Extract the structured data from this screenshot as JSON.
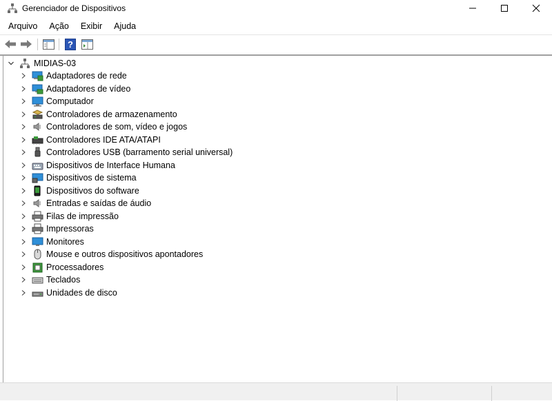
{
  "window": {
    "title": "Gerenciador de Dispositivos",
    "icon": "device-manager-icon"
  },
  "menu": [
    "Arquivo",
    "Ação",
    "Exibir",
    "Ajuda"
  ],
  "toolbar": {
    "icons": [
      "back-arrow-icon",
      "forward-arrow-icon",
      "show-hide-tree-icon",
      "help-icon",
      "properties-icon"
    ]
  },
  "tree": {
    "root": {
      "label": "MIDIAS-03",
      "icon": "computer-network-icon",
      "expanded": true
    },
    "items": [
      {
        "label": "Adaptadores de rede",
        "icon": "network-adapter-icon"
      },
      {
        "label": "Adaptadores de vídeo",
        "icon": "display-adapter-icon"
      },
      {
        "label": "Computador",
        "icon": "computer-icon"
      },
      {
        "label": "Controladores de armazenamento",
        "icon": "storage-controller-icon"
      },
      {
        "label": "Controladores de som, vídeo e jogos",
        "icon": "sound-icon"
      },
      {
        "label": "Controladores IDE ATA/ATAPI",
        "icon": "ide-controller-icon"
      },
      {
        "label": "Controladores USB (barramento serial universal)",
        "icon": "usb-icon"
      },
      {
        "label": "Dispositivos de Interface Humana",
        "icon": "hid-icon"
      },
      {
        "label": "Dispositivos de sistema",
        "icon": "system-device-icon"
      },
      {
        "label": "Dispositivos do software",
        "icon": "software-device-icon"
      },
      {
        "label": "Entradas e saídas de áudio",
        "icon": "audio-io-icon"
      },
      {
        "label": "Filas de impressão",
        "icon": "print-queue-icon"
      },
      {
        "label": "Impressoras",
        "icon": "printer-icon"
      },
      {
        "label": "Monitores",
        "icon": "monitor-icon"
      },
      {
        "label": "Mouse e outros dispositivos apontadores",
        "icon": "mouse-icon"
      },
      {
        "label": "Processadores",
        "icon": "processor-icon"
      },
      {
        "label": "Teclados",
        "icon": "keyboard-icon"
      },
      {
        "label": "Unidades de disco",
        "icon": "disk-drive-icon"
      }
    ]
  },
  "colors": {
    "accent_blue": "#2f8fd8",
    "status_bar": "#f0f0f0"
  }
}
